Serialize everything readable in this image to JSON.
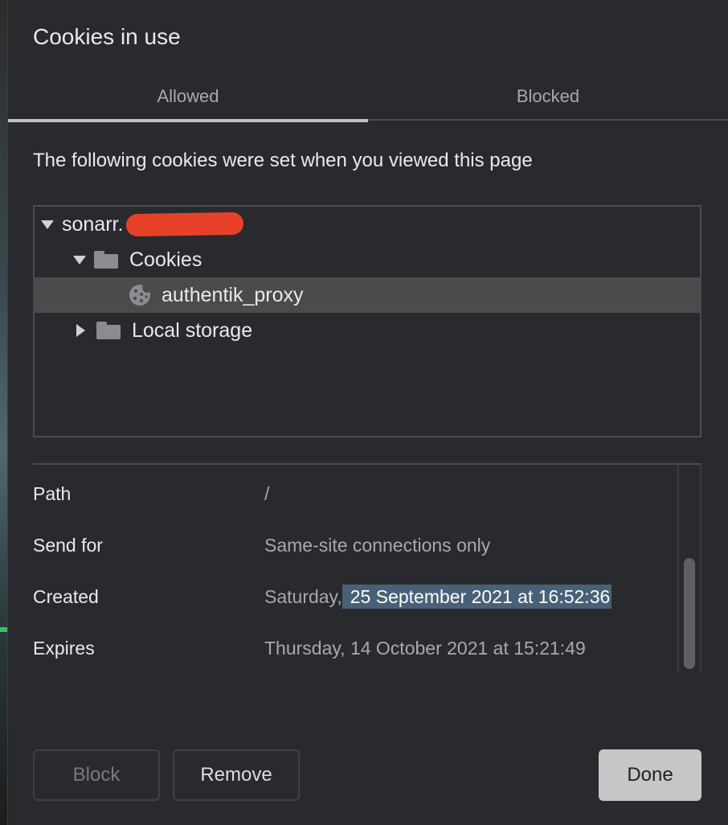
{
  "dialog": {
    "title": "Cookies in use",
    "tabs": [
      {
        "label": "Allowed",
        "active": true
      },
      {
        "label": "Blocked",
        "active": false
      }
    ],
    "description": "The following cookies were set when you viewed this page"
  },
  "tree": {
    "site": {
      "label": "sonarr.",
      "redacted": true
    },
    "cookies_folder": {
      "label": "Cookies",
      "expanded": true
    },
    "cookie_item": {
      "label": "authentik_proxy",
      "selected": true
    },
    "local_storage_folder": {
      "label": "Local storage",
      "expanded": false
    }
  },
  "details": {
    "path": {
      "label": "Path",
      "value": "/"
    },
    "send_for": {
      "label": "Send for",
      "value": "Same-site connections only"
    },
    "created": {
      "label": "Created",
      "value_prefix": "Saturday,",
      "value_highlighted": "25 September 2021 at 16:52:36"
    },
    "expires": {
      "label": "Expires",
      "value": "Thursday, 14 October 2021 at 15:21:49"
    }
  },
  "buttons": {
    "block": "Block",
    "remove": "Remove",
    "done": "Done"
  },
  "colors": {
    "dialog_bg": "#292a2d",
    "selection_bg": "#4a4b4d",
    "text_highlight": "#486178",
    "redaction": "#e8412a",
    "done_button": "#c5c6c8"
  },
  "icons": {
    "expand": "triangle-down-icon",
    "collapse": "triangle-right-icon",
    "folder": "folder-icon",
    "cookie": "cookie-icon"
  }
}
